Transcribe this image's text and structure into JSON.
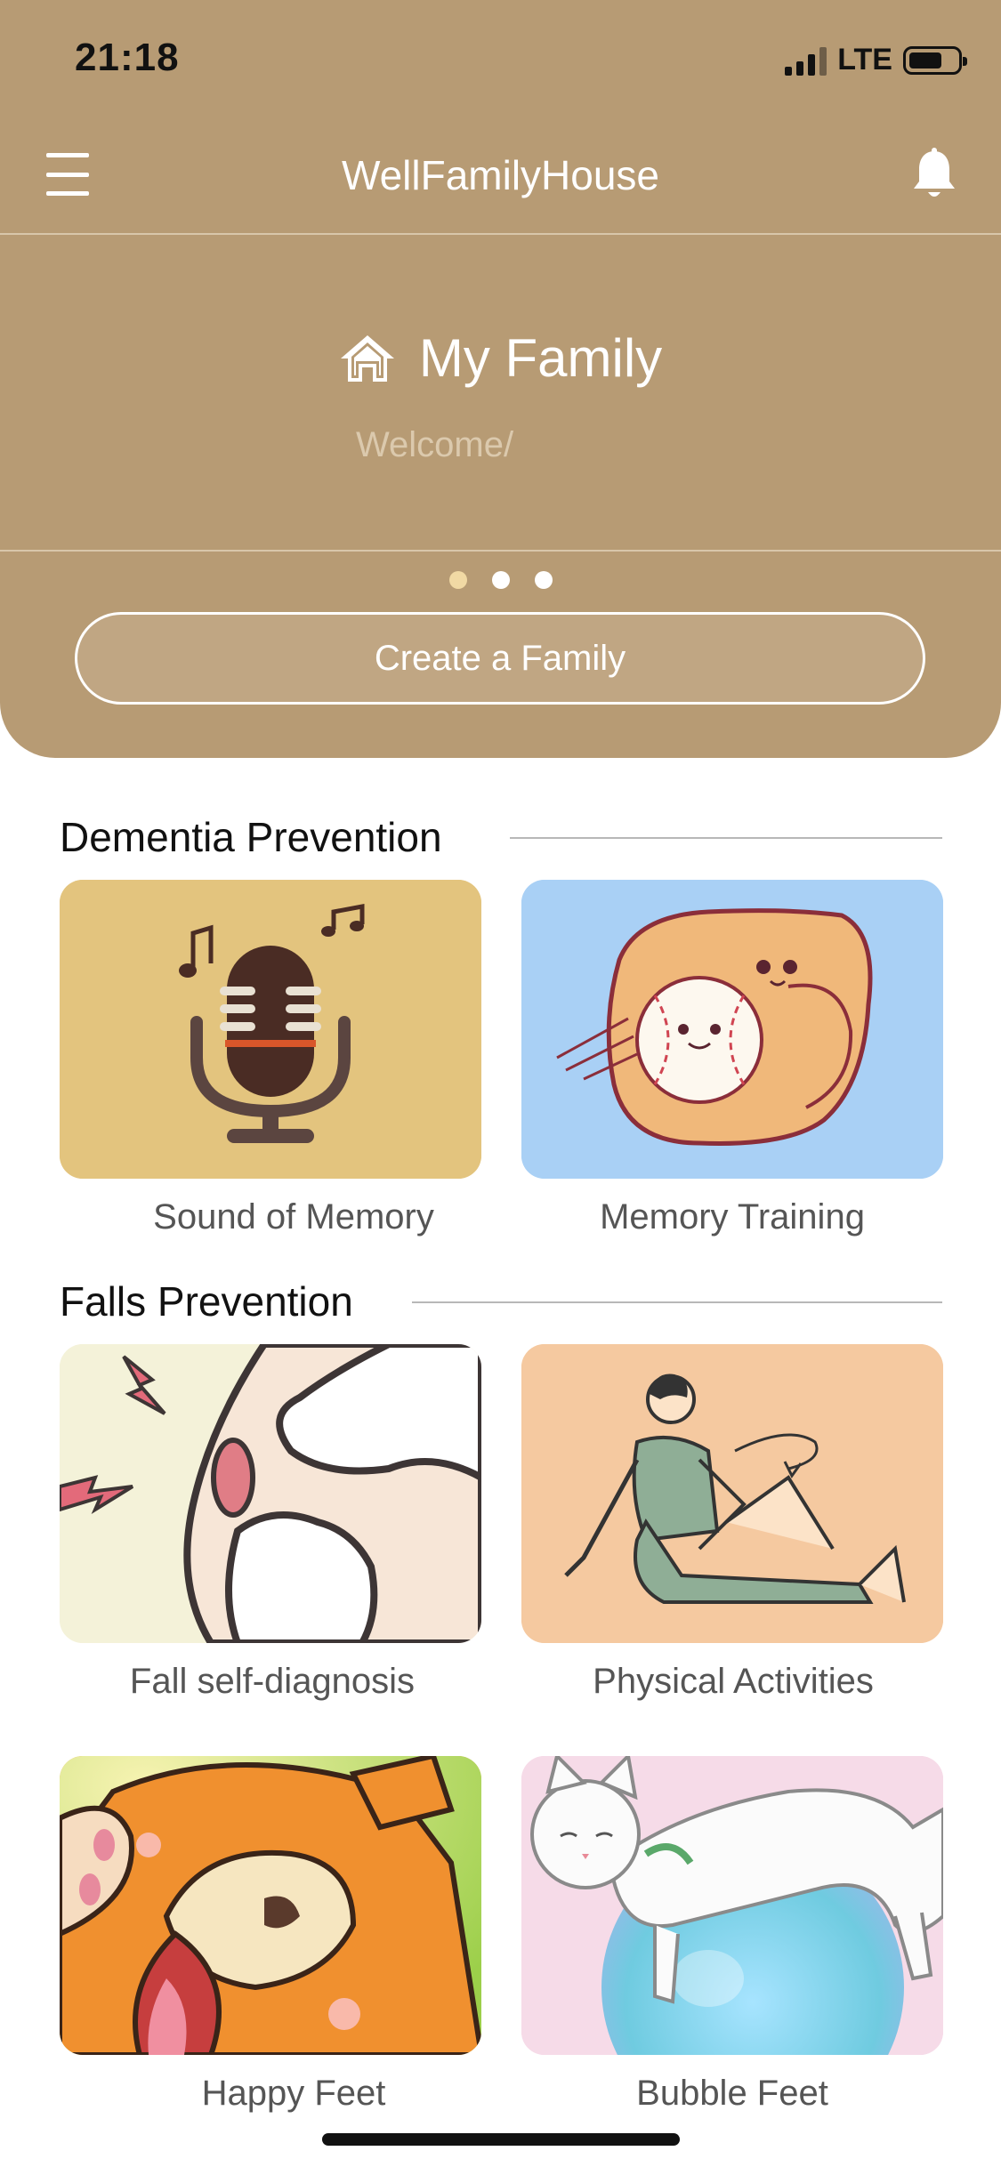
{
  "status_bar": {
    "time": "21:18",
    "network": "LTE"
  },
  "nav": {
    "title": "WellFamilyHouse",
    "menu_icon": "menu-icon",
    "bell_icon": "bell-icon"
  },
  "family": {
    "title": "My Family",
    "subtitle": "Welcome/",
    "carousel": {
      "pages": 3,
      "active_index": 0
    },
    "create_button": "Create a Family"
  },
  "colors": {
    "header_bg": "#b79b74",
    "active_dot": "#f1d9a4",
    "memory_sound_tile": "#e3c47e",
    "memory_training_tile": "#a9d0f5",
    "physical_tile": "#f5c9a0"
  },
  "sections": [
    {
      "title": "Dementia Prevention",
      "items": [
        {
          "label": "Sound of Memory",
          "icon": "microphone-icon"
        },
        {
          "label": "Memory Training",
          "icon": "baseball-glove-icon"
        }
      ]
    },
    {
      "title": "Falls Prevention",
      "items": [
        {
          "label": "Fall self-diagnosis",
          "icon": "knee-joint-icon"
        },
        {
          "label": "Physical Activities",
          "icon": "stretching-person-icon"
        },
        {
          "label": "Happy Feet",
          "icon": "dog-icon"
        },
        {
          "label": "Bubble Feet",
          "icon": "cat-on-bubble-icon"
        }
      ]
    }
  ]
}
